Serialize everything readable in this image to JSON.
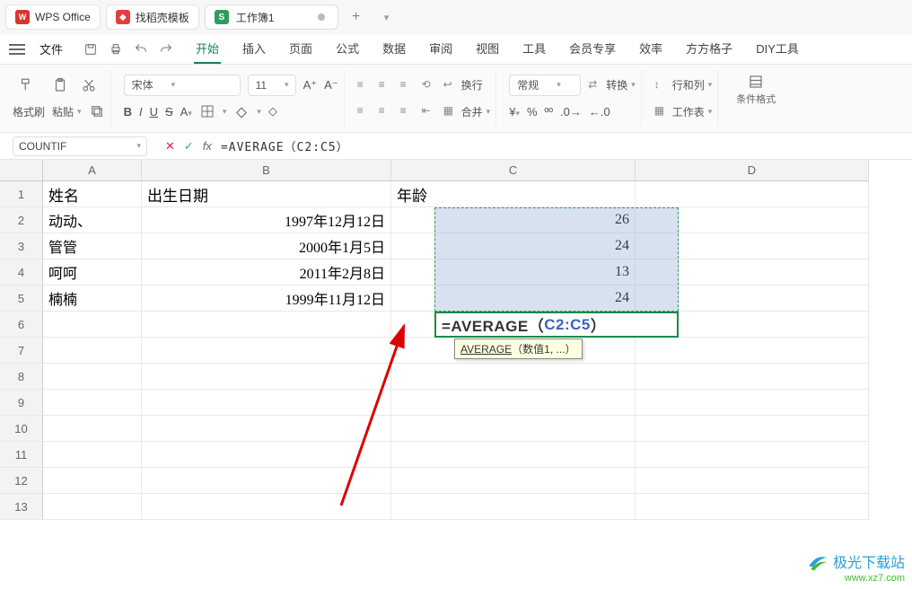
{
  "titlebar": {
    "wps_label": "WPS Office",
    "template_label": "找稻壳模板",
    "doc_name": "工作簿1",
    "add_tab": "+"
  },
  "menubar": {
    "file": "文件",
    "tabs": [
      "开始",
      "插入",
      "页面",
      "公式",
      "数据",
      "审阅",
      "视图",
      "工具",
      "会员专享",
      "效率",
      "方方格子",
      "DIY工具"
    ]
  },
  "ribbon": {
    "format_painter": "格式刷",
    "paste": "粘贴",
    "font_name": "宋体",
    "font_size": "11",
    "number_format": "常规",
    "convert": "转换",
    "rows_cols": "行和列",
    "worksheet": "工作表",
    "wrap_text": "换行",
    "merge": "合并",
    "cond_format": "条件格式"
  },
  "namebox": {
    "value": "COUNTIF",
    "fx": "fx"
  },
  "formula_bar": {
    "text": "=AVERAGE（C2:C5）"
  },
  "sheet": {
    "cols": [
      "A",
      "B",
      "C",
      "D"
    ],
    "rows": [
      "1",
      "2",
      "3",
      "4",
      "5",
      "6",
      "7",
      "8",
      "9",
      "10",
      "11",
      "12",
      "13"
    ],
    "headers": {
      "A": "姓名",
      "B": "出生日期",
      "C": "年龄"
    },
    "data": [
      {
        "A": "动动、",
        "B": "1997年12月12日",
        "C": "26"
      },
      {
        "A": "管管",
        "B": "2000年1月5日",
        "C": "24"
      },
      {
        "A": "呵呵",
        "B": "2011年2月8日",
        "C": "13"
      },
      {
        "A": "楠楠",
        "B": "1999年11月12日",
        "C": "24"
      }
    ],
    "active_formula_prefix": "=AVERAGE（",
    "active_formula_ref": "C2:C5",
    "active_formula_suffix": "）",
    "tooltip_fn": "AVERAGE",
    "tooltip_args": "（数值1, ...）"
  },
  "watermark": {
    "line1": "极光下载站",
    "line2": "www.xz7.com"
  }
}
